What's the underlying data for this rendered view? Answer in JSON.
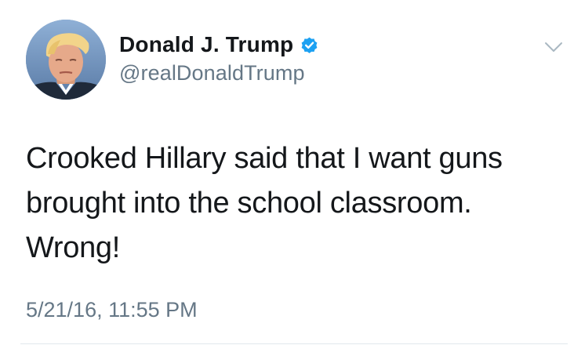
{
  "tweet": {
    "display_name": "Donald J. Trump",
    "handle": "@realDonaldTrump",
    "verified": true,
    "text": "Crooked Hillary said that I  want guns\nbrought into the school classroom.\nWrong!",
    "timestamp": "5/21/16, 11:55 PM"
  },
  "icons": {
    "verified": "verified-badge-icon",
    "menu": "chevron-down-icon",
    "avatar": "profile-avatar"
  },
  "colors": {
    "text_primary": "#14171a",
    "text_secondary": "#657786",
    "verified_blue": "#1da1f2",
    "divider": "#e1e8ed",
    "chevron": "#aab8c2"
  }
}
